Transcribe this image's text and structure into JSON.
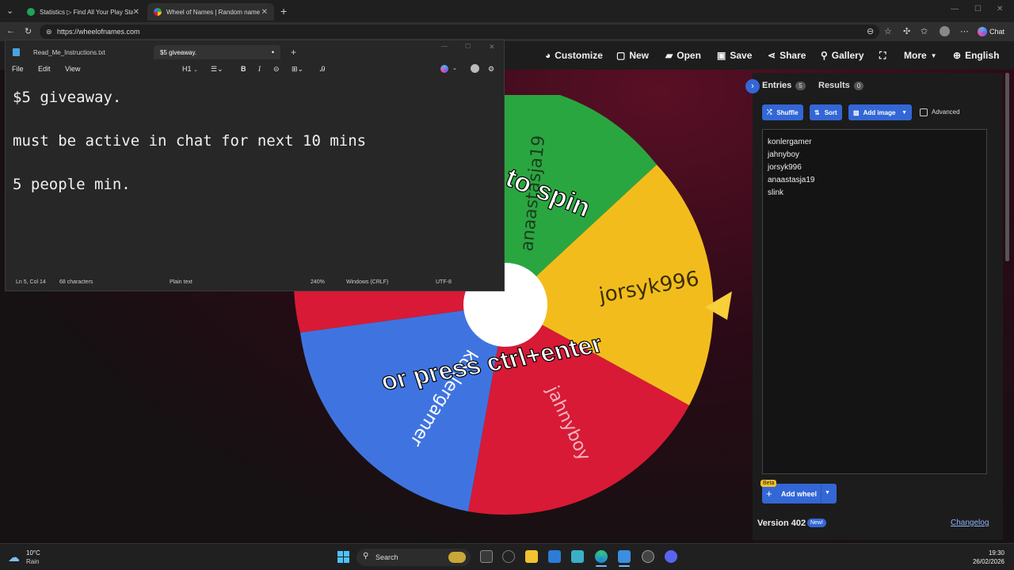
{
  "browser": {
    "tabs": [
      {
        "title": "Statistics ▷ Find All Your Play Stat"
      },
      {
        "title": "Wheel of Names | Random name"
      }
    ],
    "url": "https://wheelofnames.com",
    "chat_label": "Chat"
  },
  "site": {
    "nav": [
      "Customize",
      "New",
      "Open",
      "Save",
      "Share",
      "Gallery",
      "More",
      "English"
    ],
    "wheel": {
      "labels": [
        "anaastasja19",
        "jorsyk996",
        "jahnyboy",
        "konlergamer"
      ],
      "overlay_top": "to spin",
      "overlay_bottom": "or press ctrl+enter",
      "colors": {
        "green": "#2aa640",
        "yellow": "#f2bd1c",
        "red": "#d81a36",
        "blue": "#3f74e0"
      }
    },
    "panel": {
      "entries_label": "Entries",
      "entries_count": "5",
      "results_label": "Results",
      "results_count": "0",
      "shuffle": "Shuffle",
      "sort": "Sort",
      "add_image": "Add image",
      "advanced": "Advanced",
      "entries": [
        "konlergamer",
        "jahnyboy",
        "jorsyk996",
        "anaastasja19",
        "slink"
      ],
      "beta": "Beta",
      "add_wheel": "Add wheel",
      "version": "Version 402",
      "new_badge": "New!",
      "changelog": "Changelog"
    }
  },
  "notepad": {
    "tabs": [
      "Read_Me_Instructions.txt",
      "$5 giveaway."
    ],
    "menu": [
      "File",
      "Edit",
      "View"
    ],
    "heading": "H1",
    "lines": [
      "$5 giveaway.",
      "must be active in chat for next 10 mins",
      "5 people min."
    ],
    "status": {
      "position": "Ln 5, Col 14",
      "chars": "68 characters",
      "format": "Plain text",
      "zoom": "240%",
      "eol": "Windows (CRLF)",
      "encoding": "UTF-8"
    }
  },
  "taskbar": {
    "temp": "10°C",
    "weather": "Rain",
    "search": "Search",
    "time": "19:30",
    "date": "26/02/2026"
  }
}
